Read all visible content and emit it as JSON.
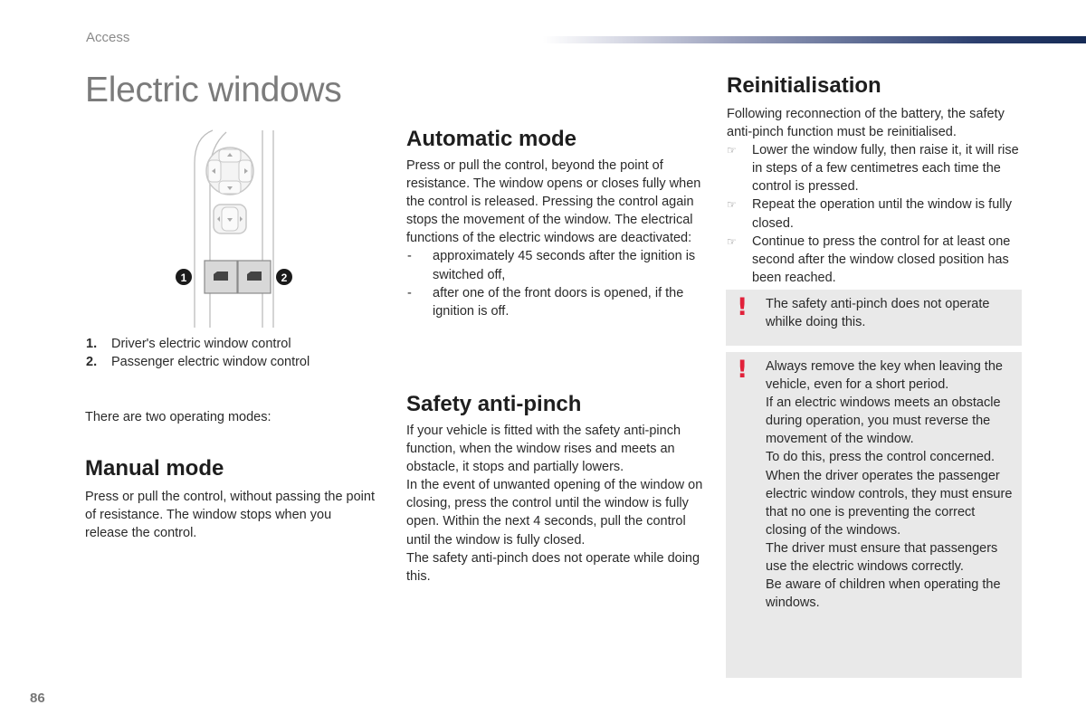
{
  "header": {
    "section": "Access",
    "accent_color": "#152a55"
  },
  "page_title": "Electric windows",
  "illustration": {
    "description": "Door armrest control panel with mirror adjuster, mirror selector and two window switches",
    "callouts": [
      "1",
      "2"
    ]
  },
  "legend": [
    {
      "num": "1.",
      "label": "Driver's electric window control"
    },
    {
      "num": "2.",
      "label": "Passenger electric window control"
    }
  ],
  "intro": "There are two operating modes:",
  "manual_mode": {
    "title": "Manual mode",
    "body": "Press or pull the control, without passing the point of resistance. The window stops when you release the control."
  },
  "automatic_mode": {
    "title": "Automatic mode",
    "body": "Press or pull the control, beyond the point of resistance. The window opens or closes fully when the control is released. Pressing the control again stops the movement of the window. The electrical functions of the electric windows are deactivated:",
    "items": [
      "approximately 45 seconds after the ignition is switched off,",
      "after one of the front doors is opened, if the ignition is off."
    ],
    "bullet": "-"
  },
  "safety_anti_pinch": {
    "title": "Safety anti-pinch",
    "paragraphs": [
      "If your vehicle is fitted with the safety anti-pinch function, when the window rises and meets an obstacle, it stops and partially lowers.",
      "In the event of unwanted opening of the window on closing, press the control until the window is fully open. Within the next 4 seconds, pull the control until the window is fully closed.",
      "The safety anti-pinch does not operate while doing this."
    ]
  },
  "reinitialisation": {
    "title": "Reinitialisation",
    "body": "Following reconnection of the battery, the safety anti-pinch function must be reinitialised.",
    "bullet_icon": "☞",
    "steps": [
      "Lower the window fully, then raise it, it will rise in steps of a few centimetres each time the control is pressed.",
      "Repeat the operation until the window is fully closed.",
      "Continue to press the control for at least one second after the window closed position has been reached."
    ]
  },
  "warnings": [
    {
      "icon": "!",
      "color": "#e1213a",
      "paragraphs": [
        "The safety anti-pinch does not operate whilke doing this."
      ]
    },
    {
      "icon": "!",
      "color": "#e1213a",
      "paragraphs": [
        "Always remove the key when leaving the vehicle, even for a short period.",
        "If an electric windows meets an obstacle during operation, you must reverse the movement of the window.",
        "To do this, press the control concerned.",
        "When the driver operates the passenger electric window controls, they must ensure that no one is preventing the correct closing of the windows.",
        "The driver must ensure that passengers use the electric windows correctly.",
        "Be aware of children when operating the windows."
      ]
    }
  ],
  "page_number": "86"
}
